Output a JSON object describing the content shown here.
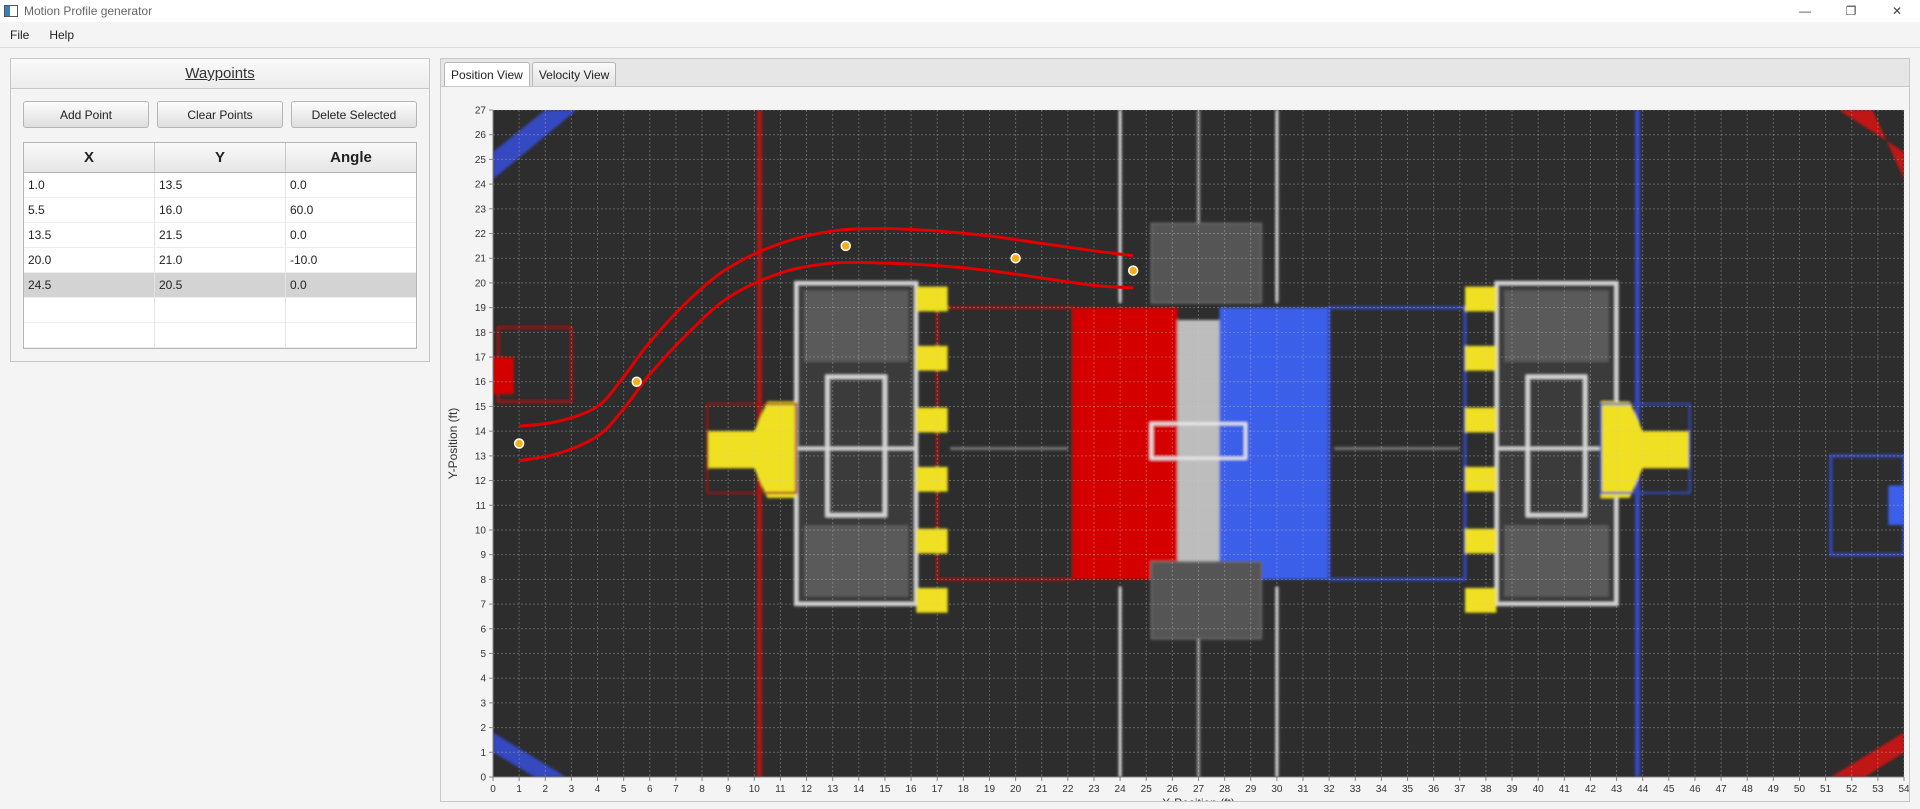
{
  "window": {
    "title": "Motion Profile generator",
    "controls": [
      "—",
      "❐",
      "✕"
    ]
  },
  "menubar": {
    "items": [
      "File",
      "Help"
    ]
  },
  "waypoints_panel": {
    "title": "Waypoints",
    "buttons": {
      "add": "Add Point",
      "clear": "Clear Points",
      "delete": "Delete Selected"
    },
    "columns": [
      "X",
      "Y",
      "Angle"
    ],
    "rows": [
      [
        "1.0",
        "13.5",
        "0.0"
      ],
      [
        "5.5",
        "16.0",
        "60.0"
      ],
      [
        "13.5",
        "21.5",
        "0.0"
      ],
      [
        "20.0",
        "21.0",
        "-10.0"
      ],
      [
        "24.5",
        "20.5",
        "0.0"
      ]
    ],
    "selected_row": 4,
    "empty_rows": 2
  },
  "tabs": [
    {
      "label": "Position View",
      "active": true
    },
    {
      "label": "Velocity View",
      "active": false
    }
  ],
  "chart_data": {
    "type": "line",
    "xlabel": "X-Position (ft)",
    "ylabel": "Y-Position (ft)",
    "xlim": [
      0,
      54
    ],
    "ylim": [
      0,
      27
    ],
    "xticks": [
      0,
      1,
      2,
      3,
      4,
      5,
      6,
      7,
      8,
      9,
      10,
      11,
      12,
      13,
      14,
      15,
      16,
      17,
      18,
      19,
      20,
      21,
      22,
      23,
      24,
      25,
      26,
      27,
      28,
      29,
      30,
      31,
      32,
      33,
      34,
      35,
      36,
      37,
      38,
      39,
      40,
      41,
      42,
      43,
      44,
      45,
      46,
      47,
      48,
      49,
      50,
      51,
      52,
      53,
      54
    ],
    "yticks": [
      0,
      1,
      2,
      3,
      4,
      5,
      6,
      7,
      8,
      9,
      10,
      11,
      12,
      13,
      14,
      15,
      16,
      17,
      18,
      19,
      20,
      21,
      22,
      23,
      24,
      25,
      26,
      27
    ],
    "grid": true,
    "background": "field image",
    "waypoints": [
      {
        "x": 1.0,
        "y": 13.5
      },
      {
        "x": 5.5,
        "y": 16.0
      },
      {
        "x": 13.5,
        "y": 21.5
      },
      {
        "x": 20.0,
        "y": 21.0
      },
      {
        "x": 24.5,
        "y": 20.5
      }
    ],
    "series": [
      {
        "color": "#e00000",
        "x": [
          1.0,
          2.5,
          4.0,
          5.0,
          6.0,
          7.5,
          9.0,
          11.0,
          13.0,
          15.0,
          17.0,
          19.0,
          21.0,
          23.0,
          24.5
        ],
        "y": [
          14.2,
          14.4,
          15.0,
          16.2,
          17.6,
          19.3,
          20.6,
          21.6,
          22.1,
          22.2,
          22.1,
          21.9,
          21.6,
          21.3,
          21.1
        ]
      },
      {
        "color": "#e00000",
        "x": [
          1.0,
          2.5,
          4.0,
          5.0,
          6.0,
          7.5,
          9.0,
          11.0,
          13.0,
          15.0,
          17.0,
          19.0,
          21.0,
          23.0,
          24.5
        ],
        "y": [
          12.8,
          13.1,
          13.8,
          14.9,
          16.3,
          18.0,
          19.4,
          20.4,
          20.8,
          20.8,
          20.7,
          20.5,
          20.2,
          19.9,
          19.8
        ]
      }
    ],
    "colors": {
      "red_alliance": "#d40000",
      "blue_alliance": "#3a5ee8",
      "cube_yellow": "#f0e020",
      "path": "#e00000",
      "waypoint": "#f2b01c",
      "carpet": "#2d2d2d"
    }
  }
}
